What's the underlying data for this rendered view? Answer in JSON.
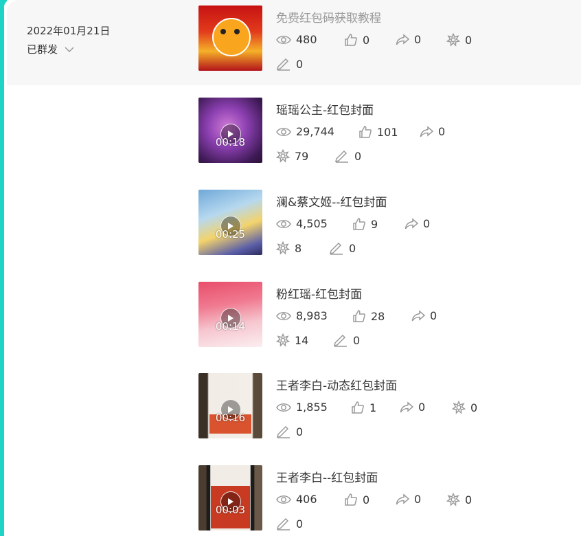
{
  "group": {
    "date": "2022年01月21日",
    "status": "已群发"
  },
  "items": [
    {
      "title": "免费红包码获取教程",
      "duration": "",
      "views": "480",
      "likes": "0",
      "shares": "0",
      "wow": "0",
      "comments": "0"
    },
    {
      "title": "瑶瑶公主-红包封面",
      "duration": "00:18",
      "views": "29,744",
      "likes": "101",
      "shares": "0",
      "wow": "79",
      "comments": "0"
    },
    {
      "title": "澜&蔡文姬--红包封面",
      "duration": "00:25",
      "views": "4,505",
      "likes": "9",
      "shares": "0",
      "wow": "8",
      "comments": "0"
    },
    {
      "title": "粉红瑶-红包封面",
      "duration": "00:14",
      "views": "8,983",
      "likes": "28",
      "shares": "0",
      "wow": "14",
      "comments": "0"
    },
    {
      "title": "王者李白-动态红包封面",
      "duration": "00:16",
      "views": "1,855",
      "likes": "1",
      "shares": "0",
      "wow": "0",
      "comments": "0"
    },
    {
      "title": "王者李白--红包封面",
      "duration": "00:03",
      "views": "406",
      "likes": "0",
      "shares": "0",
      "wow": "0",
      "comments": "0"
    }
  ]
}
